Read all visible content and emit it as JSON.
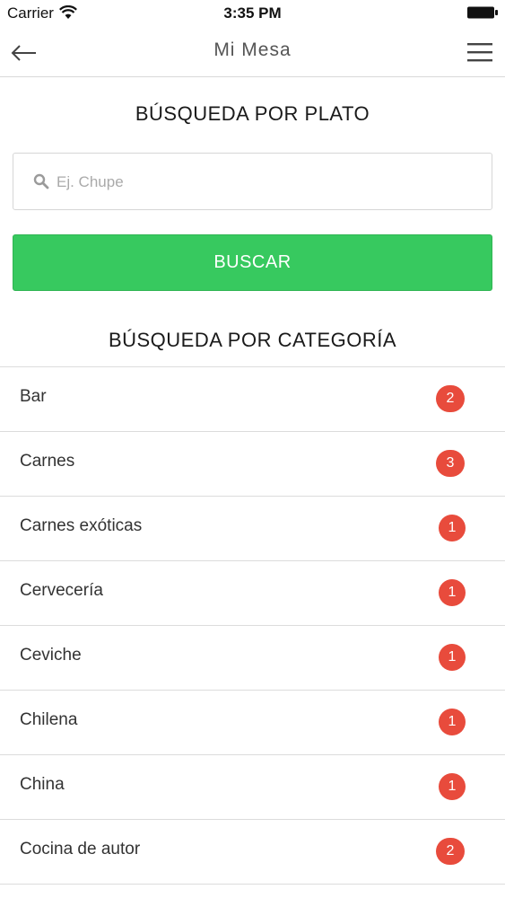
{
  "status_bar": {
    "carrier": "Carrier",
    "time": "3:35 PM"
  },
  "nav": {
    "title": "Mi Mesa",
    "back_icon": "arrow-left-icon",
    "menu_icon": "hamburger-menu-icon"
  },
  "dish_search": {
    "title": "BÚSQUEDA POR PLATO",
    "placeholder": "Ej. Chupe",
    "value": "",
    "button_label": "BUSCAR"
  },
  "category_search": {
    "title": "BÚSQUEDA POR CATEGORÍA",
    "items": [
      {
        "label": "Bar",
        "count": "2"
      },
      {
        "label": "Carnes",
        "count": "3"
      },
      {
        "label": "Carnes exóticas",
        "count": "1"
      },
      {
        "label": "Cervecería",
        "count": "1"
      },
      {
        "label": "Ceviche",
        "count": "1"
      },
      {
        "label": "Chilena",
        "count": "1"
      },
      {
        "label": "China",
        "count": "1"
      },
      {
        "label": "Cocina de autor",
        "count": "2"
      }
    ]
  },
  "colors": {
    "accent_green": "#37c95f",
    "badge_red": "#e84b3c",
    "divider": "#dcdcdc"
  }
}
